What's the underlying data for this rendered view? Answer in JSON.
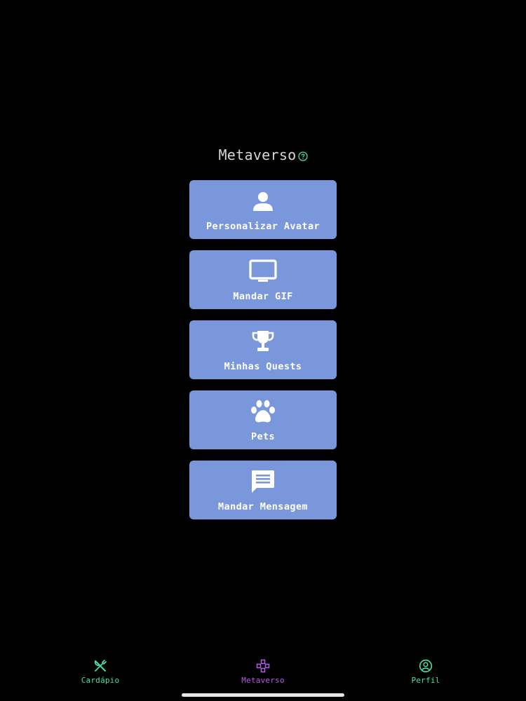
{
  "header": {
    "title": "Metaverso",
    "help_icon": "help-circle-icon",
    "help_color": "#44e0b0"
  },
  "menu": {
    "card_color": "#7b97db",
    "items": [
      {
        "label": "Personalizar Avatar",
        "icon": "person-icon"
      },
      {
        "label": "Mandar GIF",
        "icon": "monitor-icon"
      },
      {
        "label": "Minhas Quests",
        "icon": "trophy-icon"
      },
      {
        "label": "Pets",
        "icon": "paw-icon"
      },
      {
        "label": "Mandar Mensagem",
        "icon": "message-icon"
      }
    ]
  },
  "tabbar": {
    "tabs": [
      {
        "label": "Cardápio",
        "icon": "utensils-icon",
        "color": "#44e0b0",
        "active": false
      },
      {
        "label": "Metaverso",
        "icon": "gamepad-icon",
        "color": "#b45ee8",
        "active": true
      },
      {
        "label": "Perfil",
        "icon": "profile-circle-icon",
        "color": "#44e0b0",
        "active": false
      }
    ]
  }
}
